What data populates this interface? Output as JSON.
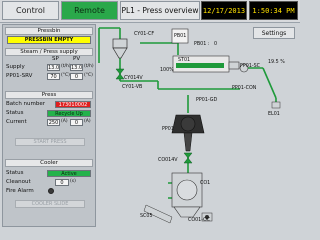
{
  "header": {
    "tab_control": "Control",
    "tab_remote": "Remote",
    "screen_title": "PL1 - Press overview",
    "date": "12/17/2013",
    "time": "1:50:34 PM"
  },
  "left_panel": {
    "pressbin": {
      "heading": "Pressbin",
      "status": "PRESSBIN EMPTY"
    },
    "steam": {
      "heading": "Steam / Press supply",
      "col_sp": "SP",
      "col_pv": "PV",
      "supply_label": "Supply",
      "supply_sp": "13.0",
      "supply_sp_unit": "(t/h)",
      "supply_pv": "13.0",
      "supply_pv_unit": "(t/h)",
      "pp01_label": "PP01-SRV",
      "pp01_sp": "70",
      "pp01_sp_unit": "(°C)",
      "pp01_pv": "0",
      "pp01_pv_unit": "(°C)"
    },
    "press": {
      "heading": "Press",
      "batch_label": "Batch number",
      "batch_value": "173010002",
      "status_label": "Status",
      "status_value": "Recycle Up",
      "current_label": "Current",
      "current_sp": "250",
      "current_sp_unit": "(A)",
      "current_pv": "0",
      "current_pv_unit": "(A)",
      "button": "START PRESS"
    },
    "cooler": {
      "heading": "Cooler",
      "status_label": "Status",
      "status_value": "Active",
      "cleanout_label": "Cleanout",
      "cleanout_value": "0",
      "cleanout_unit": "(s)",
      "fire_label": "Fire Alarm",
      "button": "COOLER SLIDE"
    }
  },
  "diagram": {
    "settings_label": "Settings",
    "pb01_tag": "PB01",
    "pb01_readout": "PB01 :",
    "pb01_value": "0",
    "cy01_cf": "CY01-CF",
    "cy01_4v": "CY014V",
    "cy01_vb": "CY01-VB",
    "st01_tag": "ST01",
    "pct_label": "100%",
    "pp01_sc": "PP01-SC",
    "pp01_con": "PP01-CON",
    "pp01_gd": "PP01-GD",
    "pp01_tag": "PP01",
    "pct2_label": "19.5 %",
    "el01": "EL01",
    "co01_4v": "CO014V",
    "co01_tag": "CO1",
    "sc05_tag": "SC05",
    "co01_oc": "CO01-OC",
    "colors": {
      "pipe_green": "#1e9a3a",
      "tank_dark": "#2f2f2f",
      "silver": "#cfd3d6",
      "panel_bg": "#cfd3d7",
      "alarm_yellow": "#ffff00",
      "active_green": "#24b24b",
      "clock_yellow": "#ffe100"
    }
  }
}
